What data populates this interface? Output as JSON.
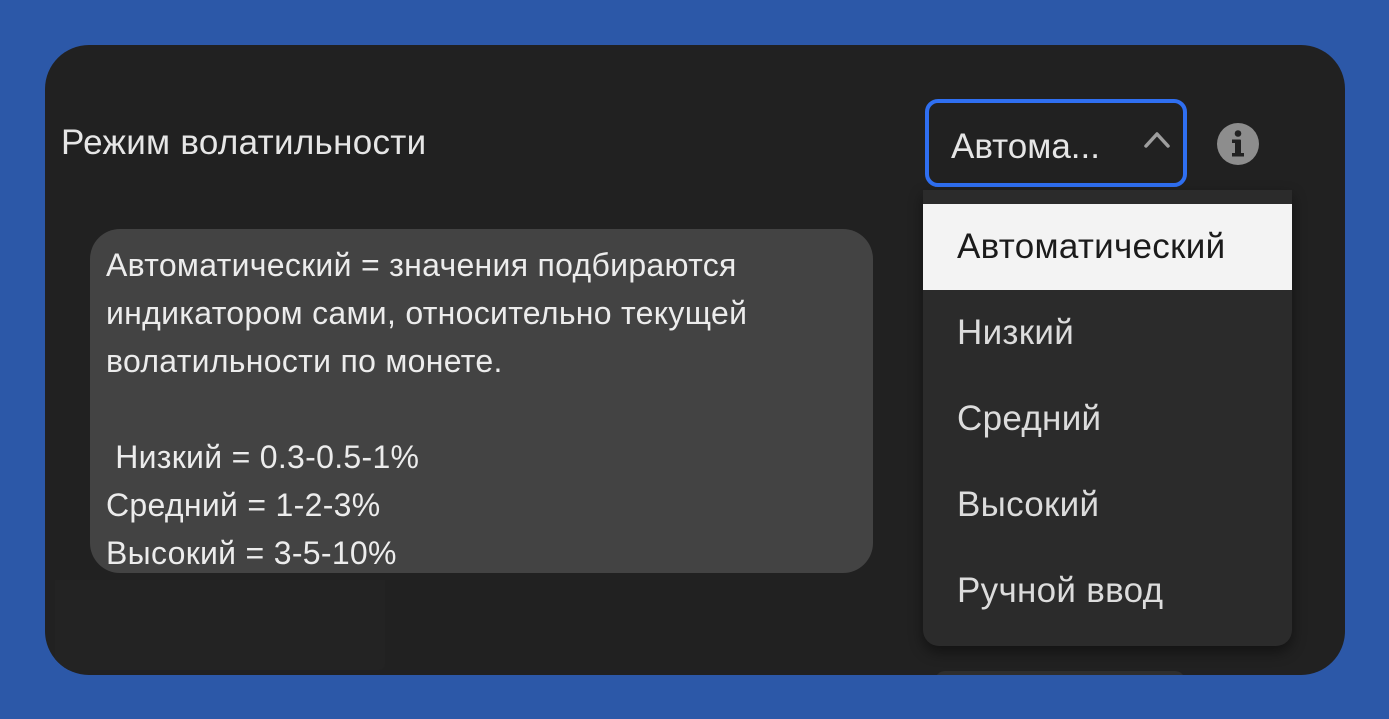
{
  "setting": {
    "label": "Режим волатильности"
  },
  "select": {
    "value": "Автома...",
    "state": "open",
    "accent_color": "#2f6ff1"
  },
  "icons": {
    "chevron": "chevron-up-icon",
    "info": "info-icon"
  },
  "tooltip": {
    "lines": [
      "Автоматический = значения подбираются",
      "индикатором сами, относительно текущей",
      "волатильности по монете.",
      "",
      " Низкий = 0.3-0.5-1%",
      "Средний = 1-2-3%",
      "Высокий = 3-5-10%"
    ]
  },
  "dropdown": {
    "options": [
      "Автоматический",
      "Низкий",
      "Средний",
      "Высокий",
      "Ручной ввод"
    ],
    "selected_index": 0
  },
  "colors": {
    "background": "#2c58a8",
    "panel": "#212121",
    "tooltip": "#434343",
    "dropdown": "#2b2b2b",
    "selected_option": "#f3f3f3"
  }
}
